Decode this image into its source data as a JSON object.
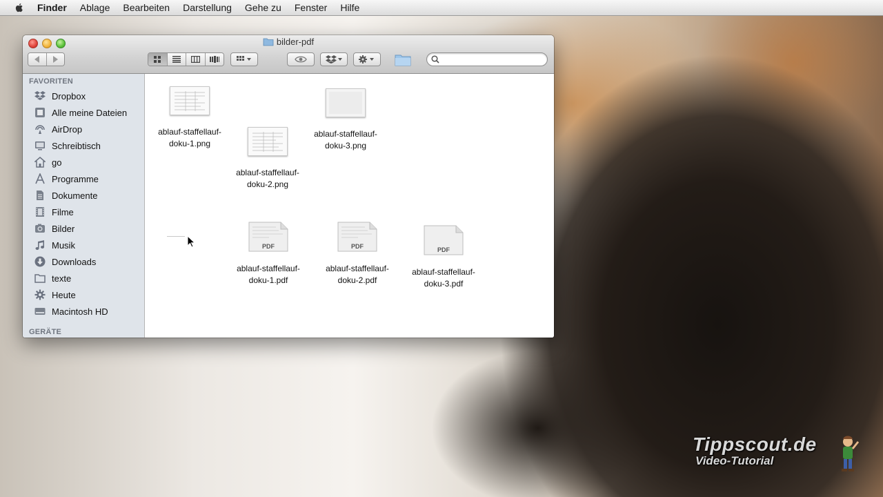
{
  "menubar": {
    "app": "Finder",
    "items": [
      "Ablage",
      "Bearbeiten",
      "Darstellung",
      "Gehe zu",
      "Fenster",
      "Hilfe"
    ]
  },
  "window": {
    "title": "bilder-pdf",
    "search_value": ""
  },
  "sidebar": {
    "favorites_header": "FAVORITEN",
    "items": [
      {
        "label": "Dropbox",
        "icon": "dropbox-icon"
      },
      {
        "label": "Alle meine Dateien",
        "icon": "all-files-icon"
      },
      {
        "label": "AirDrop",
        "icon": "airdrop-icon"
      },
      {
        "label": "Schreibtisch",
        "icon": "desktop-icon"
      },
      {
        "label": "go",
        "icon": "home-icon"
      },
      {
        "label": "Programme",
        "icon": "applications-icon"
      },
      {
        "label": "Dokumente",
        "icon": "documents-icon"
      },
      {
        "label": "Filme",
        "icon": "movies-icon"
      },
      {
        "label": "Bilder",
        "icon": "pictures-icon"
      },
      {
        "label": "Musik",
        "icon": "music-icon"
      },
      {
        "label": "Downloads",
        "icon": "downloads-icon"
      },
      {
        "label": "texte",
        "icon": "folder-icon"
      },
      {
        "label": "Heute",
        "icon": "smart-folder-icon"
      },
      {
        "label": "Macintosh HD",
        "icon": "hard-disk-icon"
      }
    ],
    "devices_header": "GERÄTE"
  },
  "files": [
    {
      "line1": "ablauf-staffellauf-",
      "line2": "doku-1.png",
      "kind": "png"
    },
    {
      "line1": "ablauf-staffellauf-",
      "line2": "doku-2.png",
      "kind": "png"
    },
    {
      "line1": "ablauf-staffellauf-",
      "line2": "doku-3.png",
      "kind": "png"
    },
    {
      "line1": "ablauf-staffellauf-",
      "line2": "doku-1.pdf",
      "kind": "pdf",
      "badge": "PDF"
    },
    {
      "line1": "ablauf-staffellauf-",
      "line2": "doku-2.pdf",
      "kind": "pdf",
      "badge": "PDF"
    },
    {
      "line1": "ablauf-staffellauf-",
      "line2": "doku-3.pdf",
      "kind": "pdf",
      "badge": "PDF"
    }
  ],
  "watermark": {
    "title": "Tippscout.de",
    "subtitle": "Video-Tutorial"
  }
}
